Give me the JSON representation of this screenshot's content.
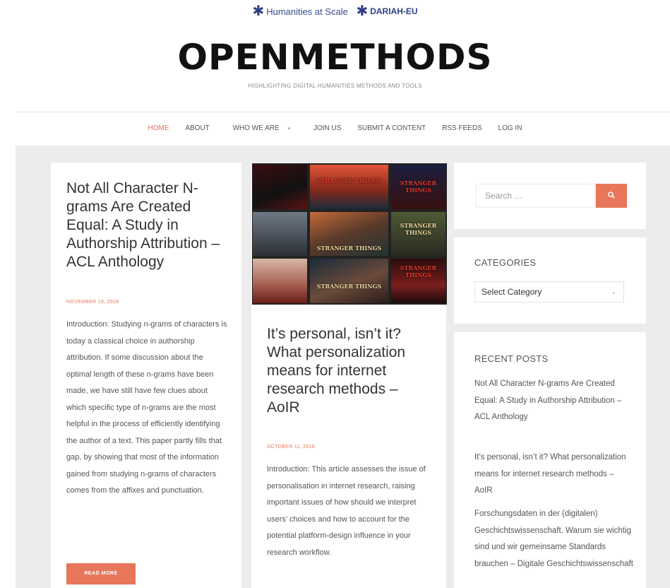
{
  "header": {
    "partner1": "Humanities at Scale",
    "partner2": "DARIAH-EU",
    "site_title": "OPENMETHODS",
    "tagline": "HIGHLIGHTING DIGITAL HUMANITIES METHODS AND TOOLS"
  },
  "nav": {
    "items": [
      "HOME",
      "ABOUT",
      "WHO WE ARE",
      "JOIN US",
      "SUBMIT A CONTENT",
      "RSS FEEDS",
      "LOG IN"
    ],
    "active": "HOME"
  },
  "posts": [
    {
      "title": "Not All Character N-grams Are Created Equal: A Study in Authorship Attribution – ACL Anthology",
      "date": "NOVEMBER 19, 2018",
      "excerpt": "Introduction: Studying n-grams of characters is today a classical choice in authorship attribution. If some discussion about the optimal length of these n-grams have been made, we have still have few clues about which specific type of n-grams are the most helpful in the process of efficiently identifying the author of a text. This paper partly fills that gap, by showing that most of the information gained from studying n-grams of characters comes from the affixes and punctuation.",
      "read_more": "READ MORE"
    },
    {
      "title": "It’s personal, isn’t it? What personalization means for internet research methods – AoIR",
      "date": "OCTOBER 11, 2018",
      "excerpt": "Introduction: This article assesses the issue of personalisation in internet research, raising important issues of how should we interpret users’ choices and how to account for the potential platform-design influence in your research workflow.",
      "image_text": [
        "STRANGER THINGS",
        "STRANGER THINGS",
        "STRANGER THINGS",
        "STRANGER THINGS",
        "STRANGER THINGS",
        "STRANGER THINGS"
      ]
    }
  ],
  "sidebar": {
    "search_placeholder": "Search …",
    "categories_title": "CATEGORIES",
    "categories_select": "Select Category",
    "recent_title": "RECENT POSTS",
    "recent_posts": [
      "Not All Character N-grams Are Created Equal: A Study in Authorship Attribution – ACL Anthology",
      "It’s personal, isn’t it? What personalization means for internet research methods – AoIR",
      "Forschungsdaten in der (digitalen) Geschichtswissenschaft. Warum sie wichtig sind und wir gemeinsame Standards brauchen – Digitale Geschichtswissenschaft"
    ]
  },
  "colors": {
    "accent": "#e8765a",
    "partner_blue": "#2f3f86",
    "content_bg": "#ececec"
  }
}
